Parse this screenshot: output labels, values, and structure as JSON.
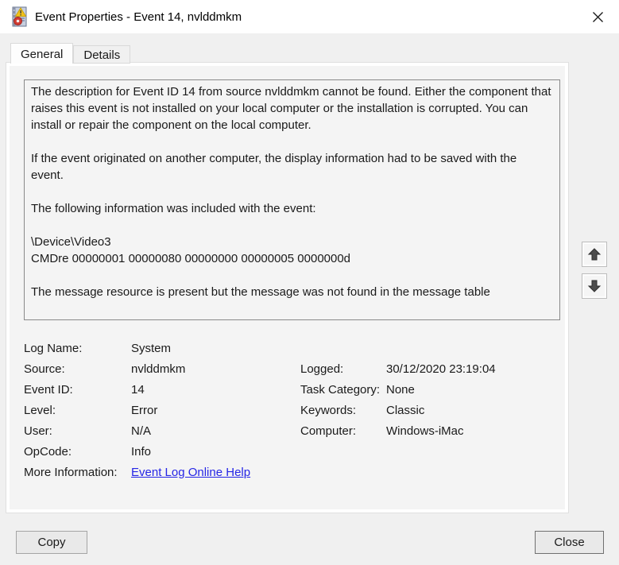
{
  "window": {
    "title": "Event Properties - Event 14, nvlddmkm"
  },
  "tabs": [
    {
      "label": "General",
      "active": true
    },
    {
      "label": "Details",
      "active": false
    }
  ],
  "description": {
    "text": "The description for Event ID 14 from source nvlddmkm cannot be found. Either the component that raises this event is not installed on your local computer or the installation is corrupted. You can install or repair the component on the local computer.\n\nIf the event originated on another computer, the display information had to be saved with the event.\n\nThe following information was included with the event:\n\n\\Device\\Video3\nCMDre 00000001 00000080 00000000 00000005 0000000d\n\nThe message resource is present but the message was not found in the message table"
  },
  "details": {
    "left": [
      {
        "label": "Log Name:",
        "value": "System"
      },
      {
        "label": "Source:",
        "value": "nvlddmkm"
      },
      {
        "label": "Event ID:",
        "value": "14"
      },
      {
        "label": "Level:",
        "value": "Error"
      },
      {
        "label": "User:",
        "value": "N/A"
      },
      {
        "label": "OpCode:",
        "value": "Info"
      }
    ],
    "right": [
      {
        "label": "Logged:",
        "value": "30/12/2020 23:19:04"
      },
      {
        "label": "Task Category:",
        "value": "None"
      },
      {
        "label": "Keywords:",
        "value": "Classic"
      },
      {
        "label": "Computer:",
        "value": "Windows-iMac"
      }
    ],
    "more_info": {
      "label": "More Information:",
      "link_text": "Event Log Online Help"
    }
  },
  "buttons": {
    "copy_label": "Copy",
    "close_label": "Close"
  },
  "icons": {
    "titlebar": "event-log-icon",
    "scroll_up": "up-arrow-icon",
    "scroll_down": "down-arrow-icon",
    "window_close": "close-icon"
  },
  "colors": {
    "link": "#2626e6",
    "titlebar_bg": "#ffffff",
    "dialog_bg": "#f0f0f0",
    "page_bg": "#f4f4f4",
    "desc_border": "#898989",
    "arrow_fill": "#4d4d4d"
  }
}
